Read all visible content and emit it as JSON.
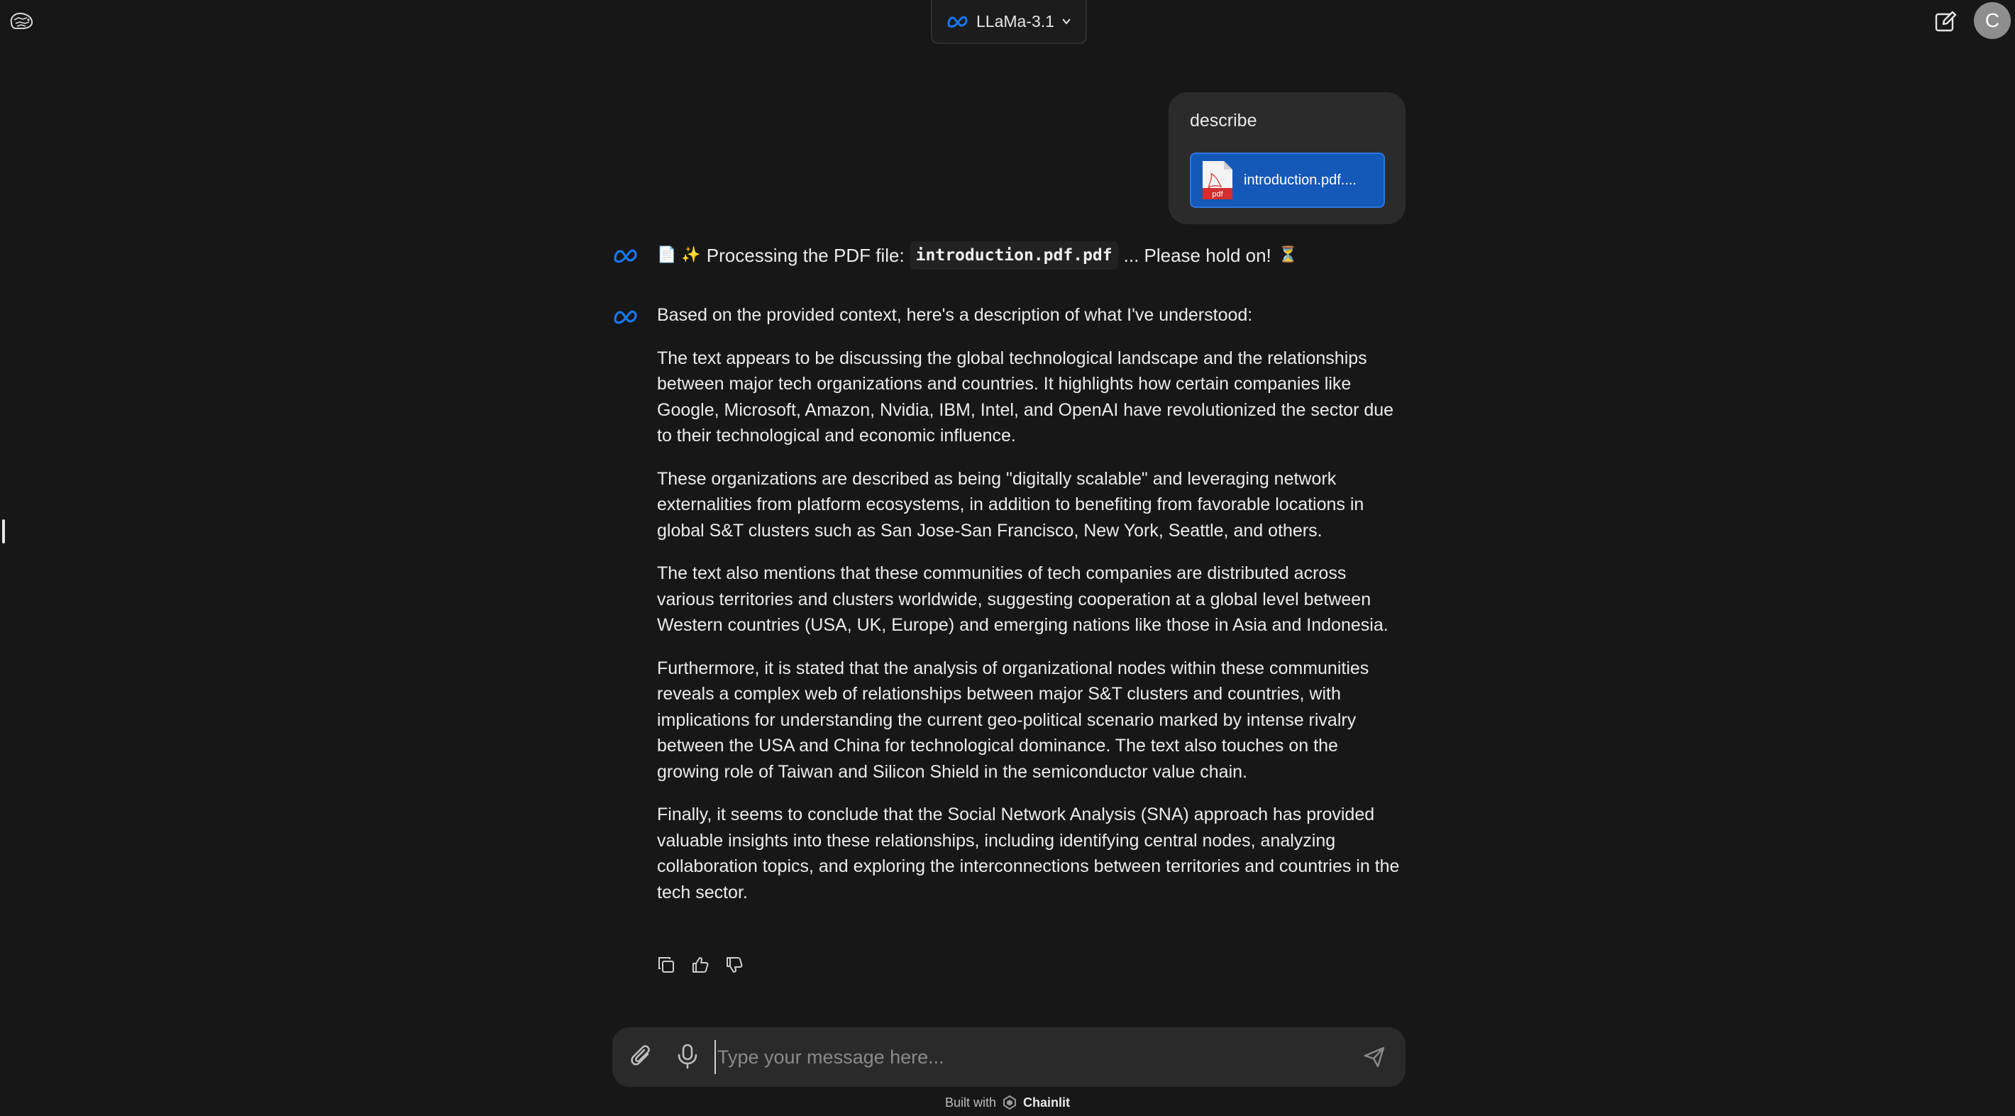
{
  "header": {
    "model_name": "LLaMa-3.1",
    "avatar_initial": "C"
  },
  "user_message": {
    "text": "describe",
    "attachment": {
      "file_name": "introduction.pdf....",
      "file_type": "pdf"
    }
  },
  "assistant": {
    "processing": {
      "emojis": "📄 ✨",
      "prefix": "Processing the PDF file:",
      "file_code": "introduction.pdf.pdf",
      "suffix": "... Please hold on!",
      "trailing_emoji": "⏳"
    },
    "response": {
      "intro": "Based on the provided context, here's a description of what I've understood:",
      "paragraphs": [
        "The text appears to be discussing the global technological landscape and the relationships between major tech organizations and countries. It highlights how certain companies like Google, Microsoft, Amazon, Nvidia, IBM, Intel, and OpenAI have revolutionized the sector due to their technological and economic influence.",
        "These organizations are described as being \"digitally scalable\" and leveraging network externalities from platform ecosystems, in addition to benefiting from favorable locations in global S&T clusters such as San Jose-San Francisco, New York, Seattle, and others.",
        "The text also mentions that these communities of tech companies are distributed across various territories and clusters worldwide, suggesting cooperation at a global level between Western countries (USA, UK, Europe) and emerging nations like those in Asia and Indonesia.",
        "Furthermore, it is stated that the analysis of organizational nodes within these communities reveals a complex web of relationships between major S&T clusters and countries, with implications for understanding the current geo-political scenario marked by intense rivalry between the USA and China for technological dominance. The text also touches on the growing role of Taiwan and Silicon Shield in the semiconductor value chain.",
        "Finally, it seems to conclude that the Social Network Analysis (SNA) approach has provided valuable insights into these relationships, including identifying central nodes, analyzing collaboration topics, and exploring the interconnections between territories and countries in the tech sector."
      ]
    }
  },
  "composer": {
    "placeholder": "Type your message here..."
  },
  "footer": {
    "prefix": "Built with",
    "brand": "Chainlit"
  },
  "colors": {
    "background": "#171717",
    "bubble": "#2b2b2b",
    "attachment": "#1459b8",
    "meta_blue": "#1877f2"
  },
  "icons": [
    "app-logo-icon",
    "meta-icon",
    "chevron-down-icon",
    "edit-icon",
    "pdf-file-icon",
    "copy-icon",
    "thumbs-up-icon",
    "thumbs-down-icon",
    "paperclip-icon",
    "microphone-icon",
    "send-icon",
    "chainlit-icon"
  ]
}
